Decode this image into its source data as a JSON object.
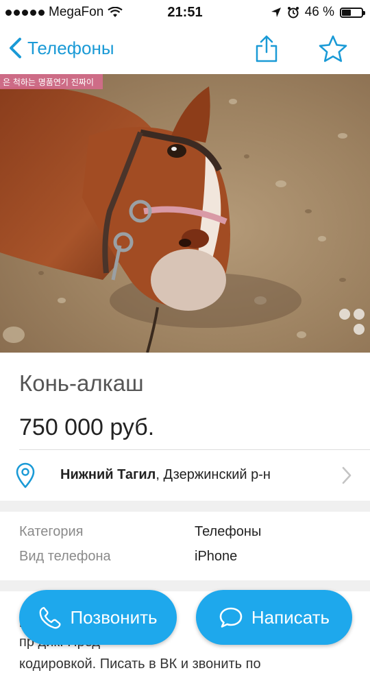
{
  "status_bar": {
    "carrier": "MegaFon",
    "time": "21:51",
    "battery_percent": "46 %",
    "battery_level": 0.46
  },
  "nav": {
    "back_label": "Телефоны",
    "icons": [
      "chevron-left-icon",
      "share-icon",
      "star-icon"
    ],
    "accent_color": "#1a9ad6"
  },
  "photo": {
    "overlay_text": "은 척하는 명품연기 진짜이"
  },
  "listing": {
    "title": "Конь-алкаш",
    "price": "750 000 руб."
  },
  "location": {
    "city": "Нижний Тагил",
    "district": ", Дзержинский р-н"
  },
  "properties": [
    {
      "label": "Категория",
      "value": "Телефоны"
    },
    {
      "label": "Вид телефона",
      "value": "iPhone"
    }
  ],
  "description": {
    "line1": "          рор",
    "line2": "пр              дик. Пред",
    "line3": "кодировкой. Писать в ВК и звонить по"
  },
  "actions": {
    "call_label": "Позвонить",
    "write_label": "Написать",
    "button_color": "#1ea8ec"
  }
}
